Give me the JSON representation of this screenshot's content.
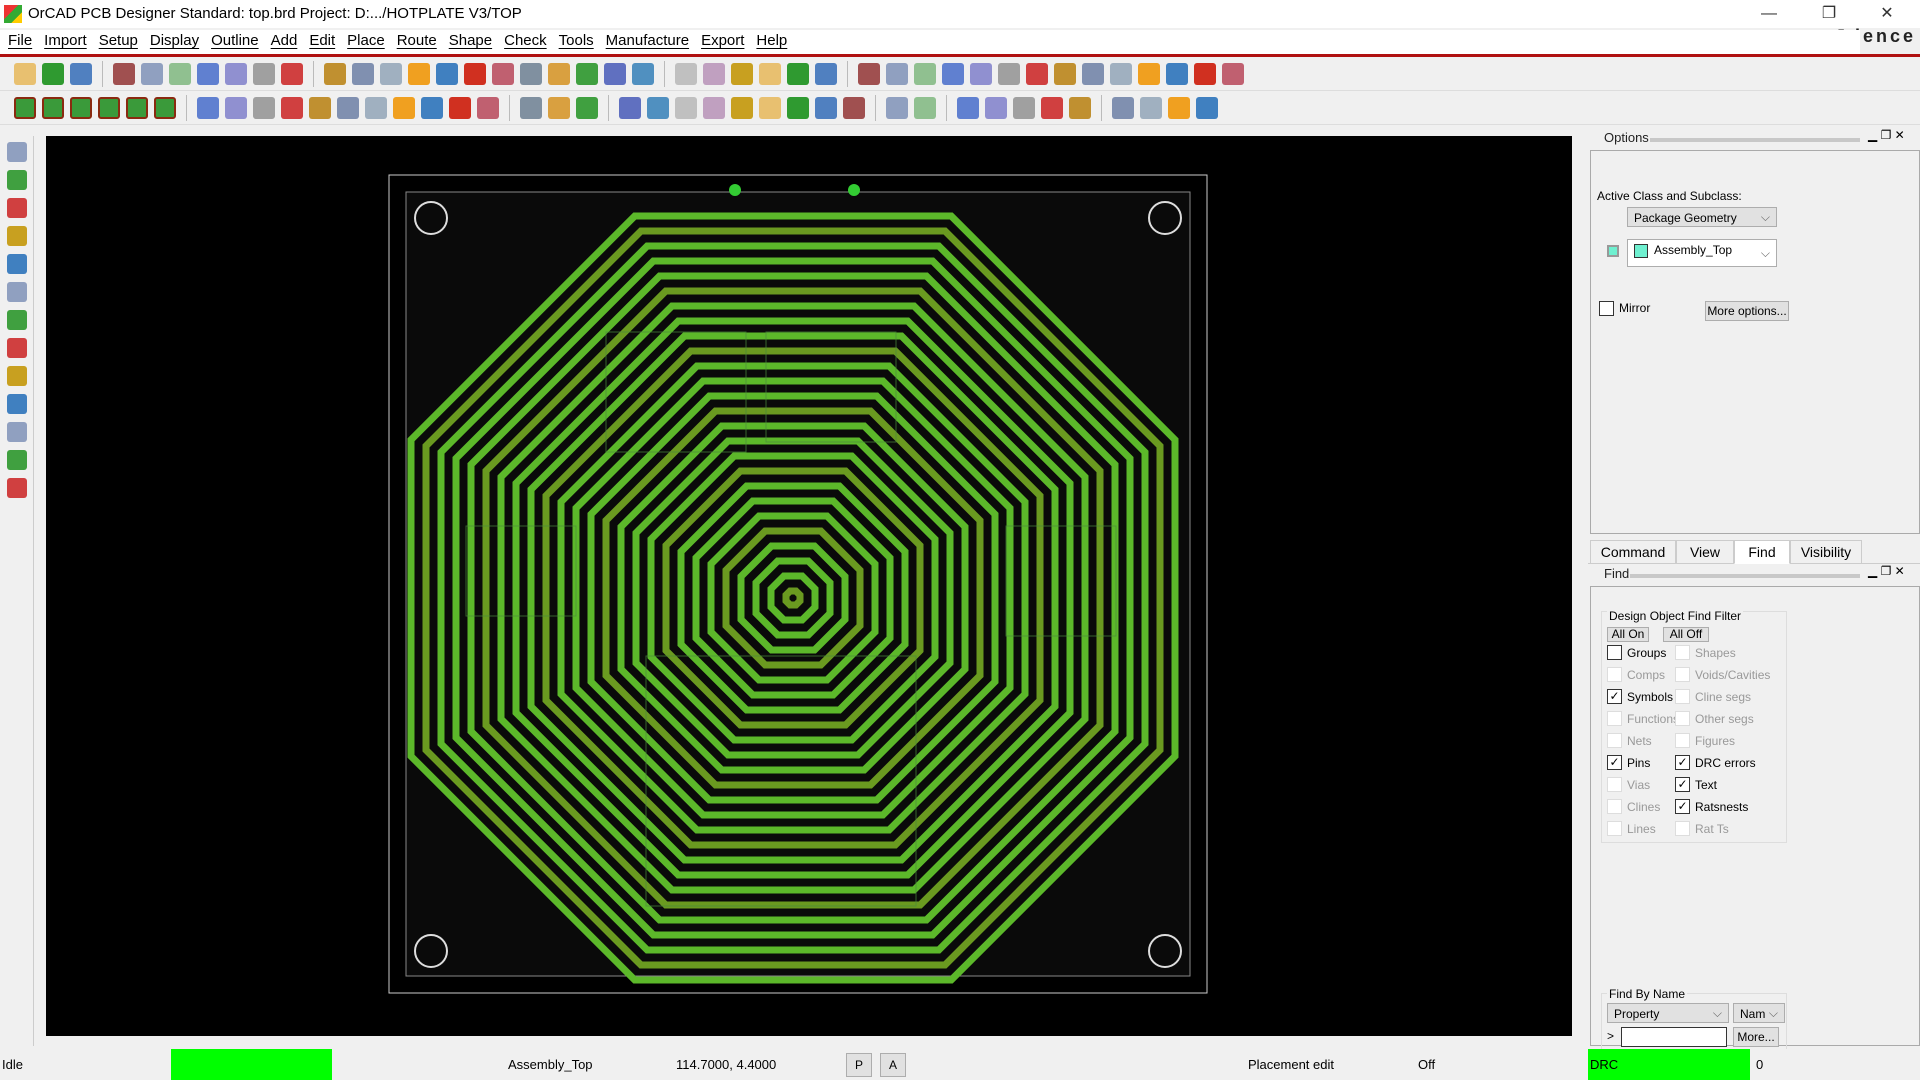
{
  "window": {
    "title": "OrCAD PCB Designer Standard: top.brd  Project: D:.../HOTPLATE V3/TOP",
    "brand": "cādence",
    "minimize": "—",
    "restore": "❐",
    "close": "✕"
  },
  "menu": [
    "File",
    "Import",
    "Setup",
    "Display",
    "Outline",
    "Add",
    "Edit",
    "Place",
    "Route",
    "Shape",
    "Check",
    "Tools",
    "Manufacture",
    "Export",
    "Help"
  ],
  "colors": {
    "trace": "#5cb82a",
    "trace_dark": "#8a7a20",
    "accent_green": "#00ff00",
    "assembly": "#6ff0d0"
  },
  "options": {
    "title": "Options",
    "active_label": "Active Class and Subclass:",
    "class_value": "Package Geometry",
    "subclass_value": "Assembly_Top",
    "mirror_label": "Mirror",
    "more_options": "More options..."
  },
  "tabs": [
    "Command",
    "View",
    "Find",
    "Visibility"
  ],
  "find": {
    "title": "Find",
    "filter_title": "Design Object Find Filter",
    "all_on": "All On",
    "all_off": "All Off",
    "items": [
      {
        "label": "Groups",
        "checked": false,
        "enabled": true
      },
      {
        "label": "Shapes",
        "checked": false,
        "enabled": false
      },
      {
        "label": "Comps",
        "checked": false,
        "enabled": false
      },
      {
        "label": "Voids/Cavities",
        "checked": false,
        "enabled": false
      },
      {
        "label": "Symbols",
        "checked": true,
        "enabled": true
      },
      {
        "label": "Cline segs",
        "checked": false,
        "enabled": false
      },
      {
        "label": "Functions",
        "checked": false,
        "enabled": false
      },
      {
        "label": "Other segs",
        "checked": false,
        "enabled": false
      },
      {
        "label": "Nets",
        "checked": false,
        "enabled": false
      },
      {
        "label": "Figures",
        "checked": false,
        "enabled": false
      },
      {
        "label": "Pins",
        "checked": true,
        "enabled": true
      },
      {
        "label": "DRC errors",
        "checked": true,
        "enabled": true
      },
      {
        "label": "Vias",
        "checked": false,
        "enabled": false
      },
      {
        "label": "Text",
        "checked": true,
        "enabled": true
      },
      {
        "label": "Clines",
        "checked": false,
        "enabled": false
      },
      {
        "label": "Ratsnests",
        "checked": true,
        "enabled": true
      },
      {
        "label": "Lines",
        "checked": false,
        "enabled": false
      },
      {
        "label": "Rat Ts",
        "checked": false,
        "enabled": false
      }
    ],
    "by_name_title": "Find By Name",
    "by_name_type": "Property",
    "by_name_field": "Nam",
    "by_name_value": "",
    "more": "More...",
    "prompt": ">"
  },
  "status": {
    "state": "Idle",
    "subclass": "Assembly_Top",
    "coords": "114.7000, 4.4000",
    "p": "P",
    "a": "A",
    "mode": "Placement edit",
    "off": "Off",
    "drc": "DRC",
    "drc_count": "0"
  }
}
